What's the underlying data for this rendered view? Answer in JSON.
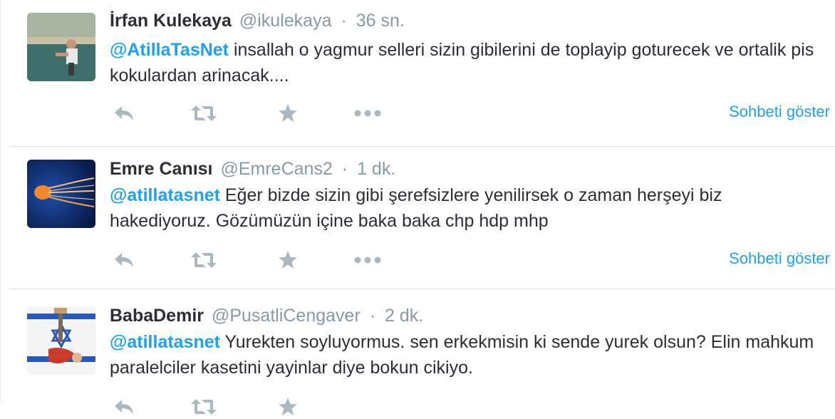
{
  "colors": {
    "link": "#1da1f2",
    "muted": "#8899a6",
    "icon": "#aab8c2",
    "text": "#292f33",
    "border": "#e1e8ed"
  },
  "tweets": [
    {
      "fullname": "İrfan Kulekaya",
      "username": "@ikulekaya",
      "separator": "·",
      "time": "36 sn.",
      "mention": "@AtillaTasNet",
      "body": " insallah o yagmur selleri sizin gibilerini de toplayip goturecek ve ortalik pis kokulardan arinacak....",
      "show_conversation": "Sohbeti göster",
      "avatar": "photo-of-person-by-pool"
    },
    {
      "fullname": "Emre Canısı",
      "username": "@EmreCans2",
      "separator": "·",
      "time": "1 dk.",
      "mention": "@atillatasnet",
      "body": " Eğer bizde sizin gibi şerefsizlere yenilirsek o zaman herşeyi biz hakediyoruz. Gözümüzün içine baka baka chp hdp mhp",
      "show_conversation": "Sohbeti göster",
      "avatar": "jellyfish-image"
    },
    {
      "fullname": "BabaDemir",
      "username": "@PusatliCengaver",
      "separator": "·",
      "time": "2 dk.",
      "mention": "@atillatasnet",
      "body": " Yurekten soyluyormus. sen erkekmisin ki sende yurek olsun? Elin mahkum paralelciler kasetini yayinlar diye bokun cikiyo.",
      "avatar": "flag-illustration"
    }
  ],
  "action_icons": [
    "reply-icon",
    "retweet-icon",
    "favorite-icon",
    "more-icon"
  ]
}
